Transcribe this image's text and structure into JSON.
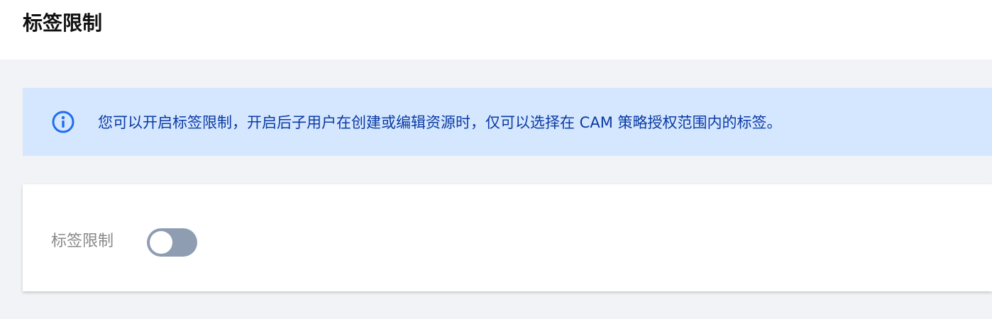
{
  "header": {
    "title": "标签限制"
  },
  "info_banner": {
    "icon": "info-circle-icon",
    "text": "您可以开启标签限制，开启后子用户在创建或编辑资源时，仅可以选择在 CAM 策略授权范围内的标签。"
  },
  "settings": {
    "tag_limit": {
      "label": "标签限制",
      "enabled": false
    }
  },
  "colors": {
    "banner_background": "#d5e7ff",
    "banner_text": "#0a3aa3",
    "toggle_off": "#8f9db3"
  }
}
